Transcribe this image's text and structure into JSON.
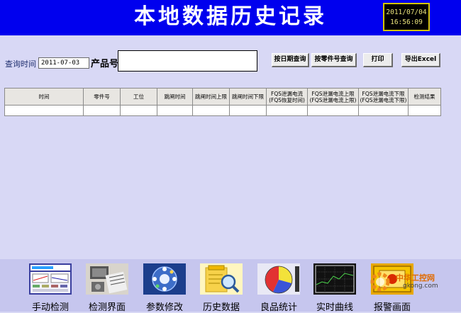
{
  "header": {
    "title": "本地数据历史记录",
    "clock_date": "2011/07/04",
    "clock_time": "16:56:09"
  },
  "query": {
    "label": "查询时间",
    "date_value": "2011-07-03",
    "product_label": "产品号:",
    "product_value": ""
  },
  "buttons": {
    "by_date": "按日期查询",
    "by_part": "按零件号查询",
    "print": "打印",
    "export": "导出Excel"
  },
  "table": {
    "columns": [
      "时间",
      "零件号",
      "工位",
      "跳闸时间",
      "跳闸时间上限",
      "跳闸时间下限",
      "FQS泄漏电流\n(FQS恢复时间)",
      "FQS泄漏电流上限\n(FQS泄漏电流上限)",
      "FQS泄漏电流下限\n(FQS泄漏电流下限)",
      "检测结果"
    ],
    "rows": [
      [
        "",
        "",
        "",
        "",
        "",
        "",
        "",
        "",
        "",
        ""
      ]
    ]
  },
  "nav": [
    {
      "label": "手动检测",
      "icon": "manual-test-icon"
    },
    {
      "label": "检测界面",
      "icon": "test-screen-icon"
    },
    {
      "label": "参数修改",
      "icon": "parameter-edit-icon"
    },
    {
      "label": "历史数据",
      "icon": "history-data-icon"
    },
    {
      "label": "良品统计",
      "icon": "good-product-pie-icon"
    },
    {
      "label": "实时曲线",
      "icon": "realtime-curve-icon"
    },
    {
      "label": "报警画面",
      "icon": "alarm-screen-icon"
    }
  ],
  "watermark": {
    "text_cn": "中华工控网",
    "text_en": "gkong.com"
  },
  "colors": {
    "header_bg": "#0000ee",
    "page_bg": "#d8d8f5",
    "nav_bg": "#c6c6ee",
    "clock_border": "#d4c400"
  }
}
